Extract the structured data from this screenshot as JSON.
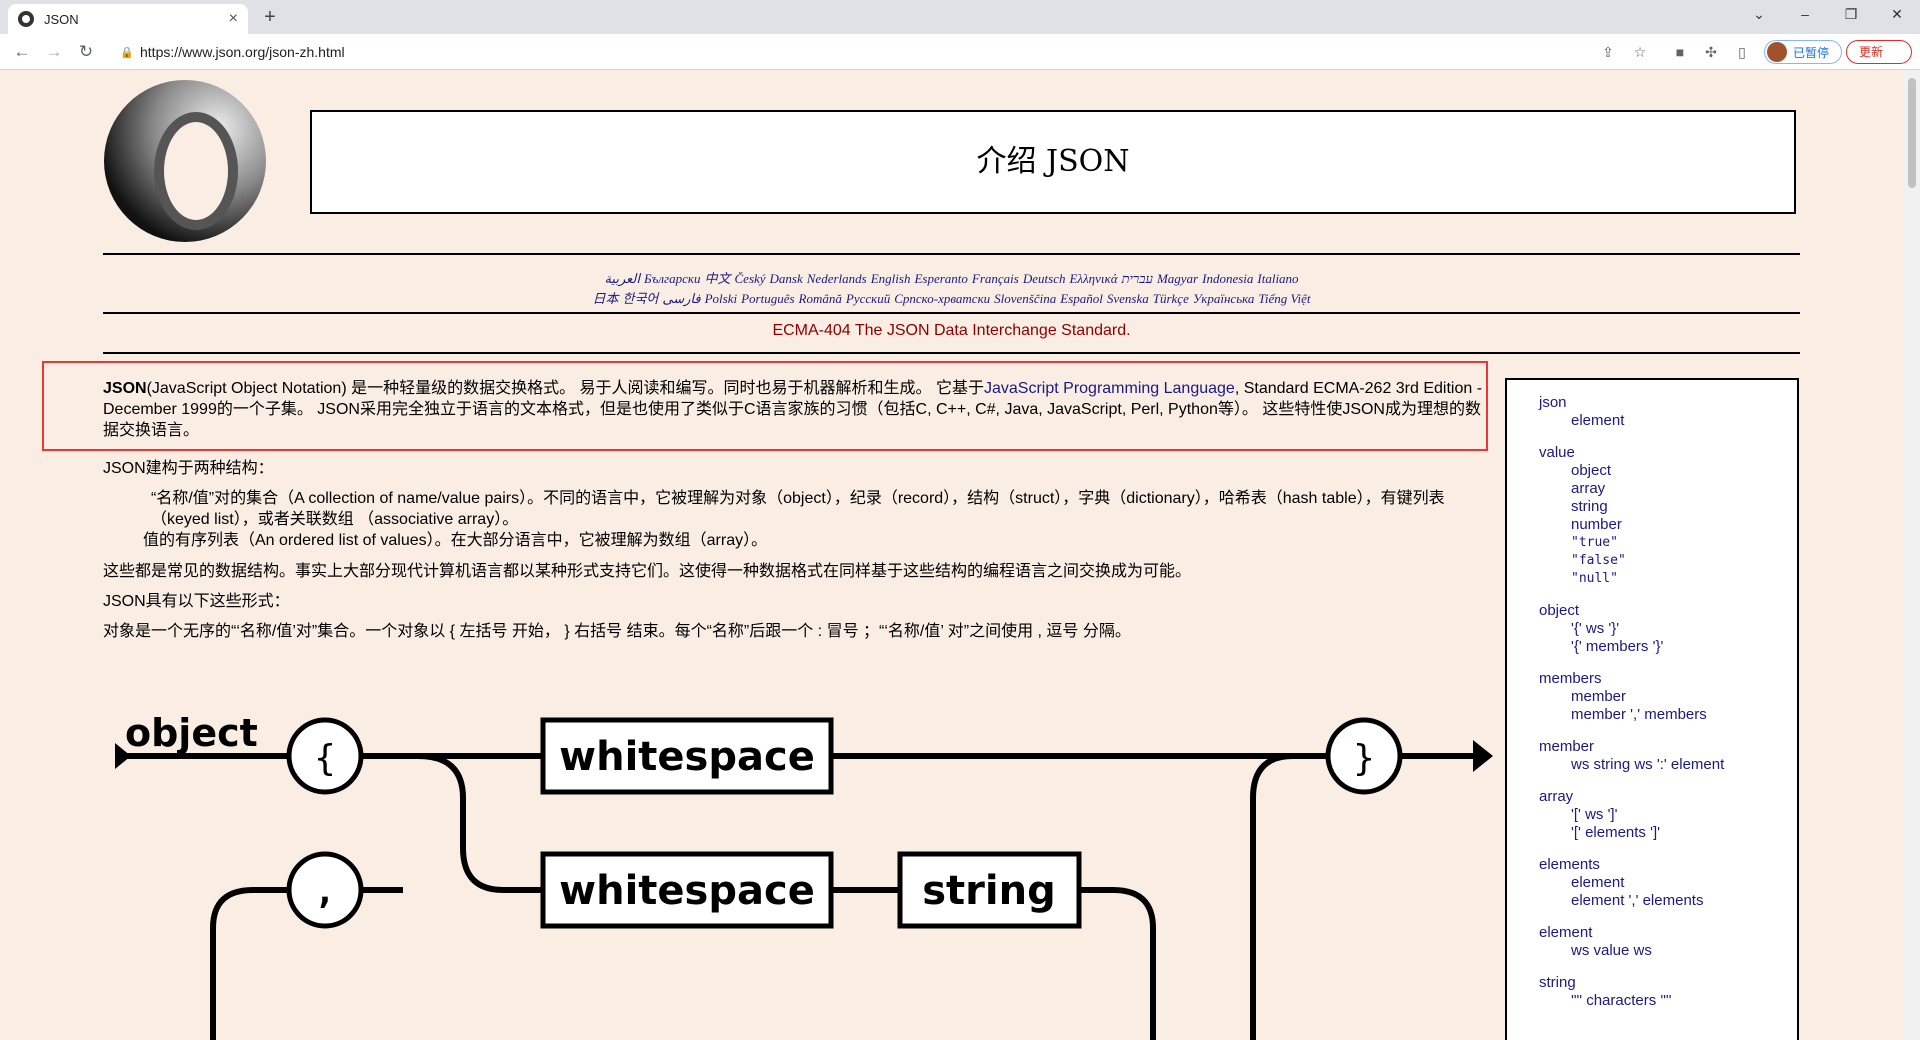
{
  "browser": {
    "tab_title": "JSON",
    "tab_close": "×",
    "new_tab": "+",
    "url": "https://www.json.org/json-zh.html",
    "profile_status": "已暂停",
    "update_label": "更新",
    "window_buttons": [
      "⌄",
      "–",
      "❐",
      "✕"
    ]
  },
  "page": {
    "title": "介绍 JSON",
    "languages_line1": [
      "العربية",
      "Български",
      "中文",
      "Český",
      "Dansk",
      "Nederlands",
      "English",
      "Esperanto",
      "Français",
      "Deutsch",
      "Ελληνικά",
      "עברית",
      "Magyar",
      "Indonesia",
      "Italiano"
    ],
    "languages_line2": [
      "日本",
      "한국어",
      "فارسی",
      "Polski",
      "Português",
      "Română",
      "Русский",
      "Српско-хрватски",
      "Slovenščina",
      "Español",
      "Svenska",
      "Türkçe",
      "Українська",
      "Tiếng Việt"
    ],
    "ecma_link": "ECMA-404 The JSON Data Interchange Standard.",
    "intro_bold": "JSON",
    "intro_text_1": "(JavaScript Object Notation) 是一种轻量级的数据交换格式。 易于人阅读和编写。同时也易于机器解析和生成。 它基于",
    "intro_link": "JavaScript Programming Language",
    "intro_text_2": ", Standard ECMA-262 3rd Edition - December 1999的一个子集。 JSON采用完全独立于语言的文本格式，但是也使用了类似于C语言家族的习惯（包括C, C++, C#, Java, JavaScript, Perl, Python等）。 这些特性使JSON成为理想的数据交换语言。",
    "structures_intro": "JSON建构于两种结构：",
    "structure_1": "“名称/值”对的集合（A collection of name/value pairs）。不同的语言中，它被理解为对象（object），纪录（record），结构（struct），字典（dictionary），哈希表（hash table），有键列表（keyed list），或者关联数组 （associative array）。",
    "structure_2": "值的有序列表（An ordered list of values）。在大部分语言中，它被理解为数组（array）。",
    "common_structures": "这些都是常见的数据结构。事实上大部分现代计算机语言都以某种形式支持它们。这使得一种数据格式在同样基于这些结构的编程语言之间交换成为可能。",
    "forms_intro": "JSON具有以下这些形式：",
    "object_desc": "对象是一个无序的“‘名称/值’对”集合。一个对象以 { 左括号 开始， } 右括号 结束。每个“名称”后跟一个 : 冒号 ；“‘名称/值’ 对”之间使用 , 逗号 分隔。"
  },
  "diagram": {
    "title": "object",
    "open_brace": "{",
    "close_brace": "}",
    "comma": ",",
    "whitespace_1": "whitespace",
    "whitespace_2": "whitespace",
    "string": "string"
  },
  "sidebar": [
    {
      "head": "json",
      "items": [
        "element"
      ]
    },
    {
      "head": "value",
      "items": [
        "object",
        "array",
        "string",
        "number",
        "\"true\"",
        "\"false\"",
        "\"null\""
      ]
    },
    {
      "head": "object",
      "items": [
        "'{' ws '}'",
        "'{' members '}'"
      ]
    },
    {
      "head": "members",
      "items": [
        "member",
        "member ',' members"
      ]
    },
    {
      "head": "member",
      "items": [
        "ws string ws ':' element"
      ]
    },
    {
      "head": "array",
      "items": [
        "'[' ws ']'",
        "'[' elements ']'"
      ]
    },
    {
      "head": "elements",
      "items": [
        "element",
        "element ',' elements"
      ]
    },
    {
      "head": "element",
      "items": [
        "ws value ws"
      ]
    },
    {
      "head": "string",
      "items": [
        "'\"' characters '\"'"
      ]
    }
  ]
}
